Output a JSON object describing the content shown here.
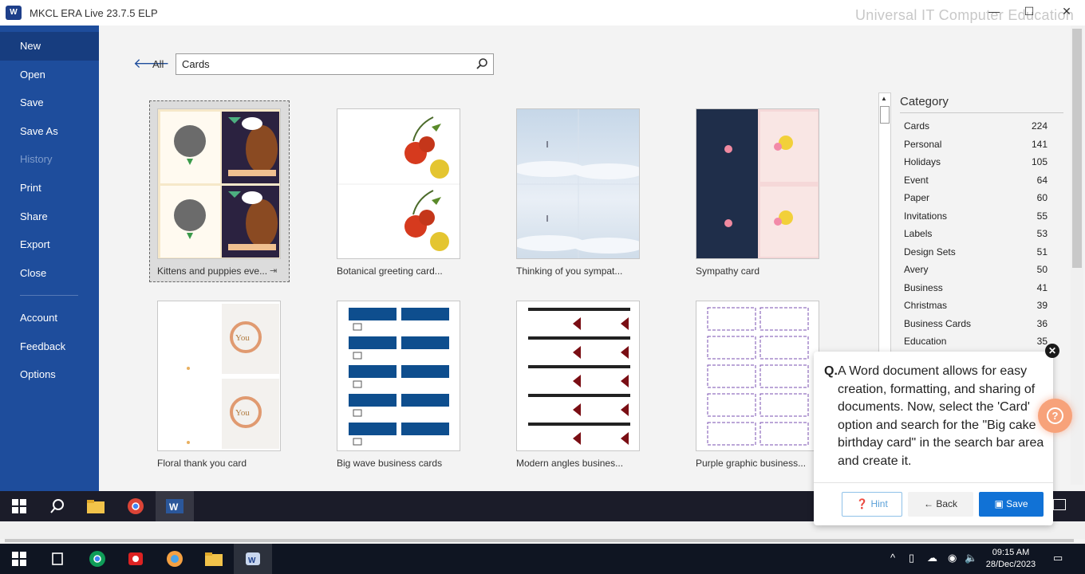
{
  "window": {
    "app_title": "MKCL ERA Live 23.7.5 ELP",
    "watermark": "Universal IT Computer Education"
  },
  "sidebar": {
    "items": [
      {
        "label": "New"
      },
      {
        "label": "Open"
      },
      {
        "label": "Save"
      },
      {
        "label": "Save As"
      },
      {
        "label": "History"
      },
      {
        "label": "Print"
      },
      {
        "label": "Share"
      },
      {
        "label": "Export"
      },
      {
        "label": "Close"
      },
      {
        "label": "Account"
      },
      {
        "label": "Feedback"
      },
      {
        "label": "Options"
      }
    ]
  },
  "search": {
    "back_label": "All",
    "value": "Cards"
  },
  "templates": [
    {
      "label": "Kittens and puppies eve..."
    },
    {
      "label": "Botanical greeting card..."
    },
    {
      "label": "Thinking of you sympat..."
    },
    {
      "label": "Sympathy card"
    },
    {
      "label": "Floral thank you card"
    },
    {
      "label": "Big wave business cards"
    },
    {
      "label": "Modern angles busines..."
    },
    {
      "label": "Purple graphic business..."
    }
  ],
  "category": {
    "title": "Category",
    "items": [
      {
        "name": "Cards",
        "count": "224"
      },
      {
        "name": "Personal",
        "count": "141"
      },
      {
        "name": "Holidays",
        "count": "105"
      },
      {
        "name": "Event",
        "count": "64"
      },
      {
        "name": "Paper",
        "count": "60"
      },
      {
        "name": "Invitations",
        "count": "55"
      },
      {
        "name": "Labels",
        "count": "53"
      },
      {
        "name": "Design Sets",
        "count": "51"
      },
      {
        "name": "Avery",
        "count": "50"
      },
      {
        "name": "Business",
        "count": "41"
      },
      {
        "name": "Christmas",
        "count": "39"
      },
      {
        "name": "Business Cards",
        "count": "36"
      },
      {
        "name": "Education",
        "count": "35"
      }
    ]
  },
  "dialog": {
    "prefix": "Q.",
    "question": "A Word document allows for easy creation, formatting, and sharing of documents. Now, select the 'Card' option and search for the \"Big cake birthday card\" in the search bar area and create it.",
    "hint_label": "Hint",
    "back_label": "Back",
    "save_label": "Save"
  },
  "taskbar": {
    "time": "09:15 AM",
    "date": "28/Dec/2023"
  },
  "colors": {
    "sidebar": "#1e4d9c",
    "accent": "#1172d6"
  }
}
